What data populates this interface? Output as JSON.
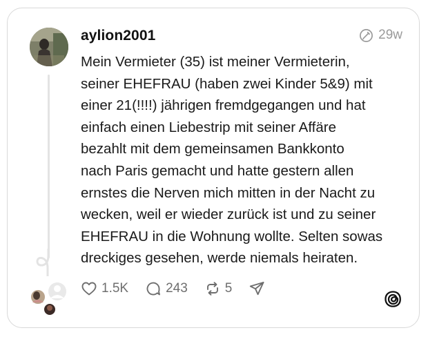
{
  "post": {
    "username": "aylion2001",
    "time": "29w",
    "text": "Mein Vermieter (35) ist meiner Vermieterin,\nseiner EHEFRAU (haben zwei Kinder 5&9) mit\neiner 21(!!!!) jährigen fremdgegangen und hat\neinfach einen Liebestrip mit seiner Affäre\nbezahlt mit dem gemeinsamen Bankkonto\nnach Paris gemacht und hatte gestern allen\nernstes die Nerven mich mitten in der Nacht zu\nwecken, weil er wieder zurück ist und zu seiner\nEHEFRAU in die Wohnung wollte. Selten sowas\ndreckiges gesehen, werde niemals heiraten."
  },
  "actions": {
    "likes": "1.5K",
    "replies": "243",
    "reposts": "5"
  },
  "icons": {
    "time": "edited-clock-icon",
    "like": "heart-icon",
    "reply": "speech-bubble-icon",
    "repost": "repost-arrows-icon",
    "share": "send-icon",
    "brand": "threads-logo-icon"
  },
  "colors": {
    "border": "#d8d8d8",
    "muted": "#9a9a9a",
    "text": "#1a1a1a"
  }
}
